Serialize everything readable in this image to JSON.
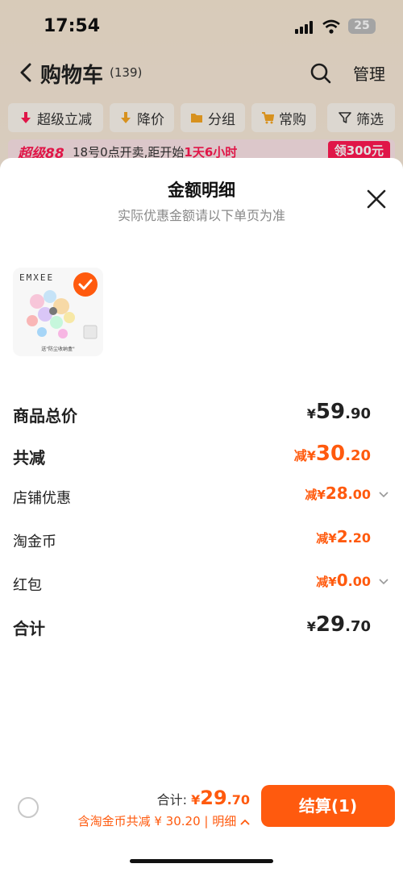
{
  "status": {
    "time": "17:54",
    "battery": "25"
  },
  "header": {
    "title": "购物车",
    "count": "(139)",
    "manage": "管理"
  },
  "filters": {
    "super_discount": "超级立减",
    "price_drop": "降价",
    "group": "分组",
    "frequent": "常购",
    "filter": "筛选"
  },
  "promo": {
    "logo": "超级88",
    "text": "18号0点开卖,距开始",
    "countdown": "1天6小时",
    "button": "领300元"
  },
  "sheet": {
    "title": "金额明细",
    "subtitle": "实际优惠金额请以下单页为准",
    "product": {
      "brand": "EMXEE",
      "caption": "送\"防尘收纳盒\"",
      "selected": true
    },
    "rows": {
      "subtotal": {
        "label": "商品总价",
        "prefix": "¥",
        "int": "59",
        "dec": ".90"
      },
      "total_discount": {
        "label": "共减",
        "prefix": "减¥",
        "int": "30",
        "dec": ".20"
      },
      "shop_discount": {
        "label": "店铺优惠",
        "prefix": "减¥",
        "int": "28",
        "dec": ".00"
      },
      "taojinbi": {
        "label": "淘金币",
        "prefix": "减¥",
        "int": "2",
        "dec": ".20"
      },
      "red_packet": {
        "label": "红包",
        "prefix": "减¥",
        "int": "0",
        "dec": ".00"
      },
      "total": {
        "label": "合计",
        "prefix": "¥",
        "int": "29",
        "dec": ".70"
      }
    }
  },
  "footer": {
    "total_label": "合计:",
    "total_prefix": "¥",
    "total_int": "29",
    "total_dec": ".70",
    "discount_text": "含淘金币共减 ¥ 30.20 | 明细",
    "checkout": "结算(1)"
  },
  "colors": {
    "accent": "#ff5a0e",
    "promo": "#ff1a52"
  }
}
